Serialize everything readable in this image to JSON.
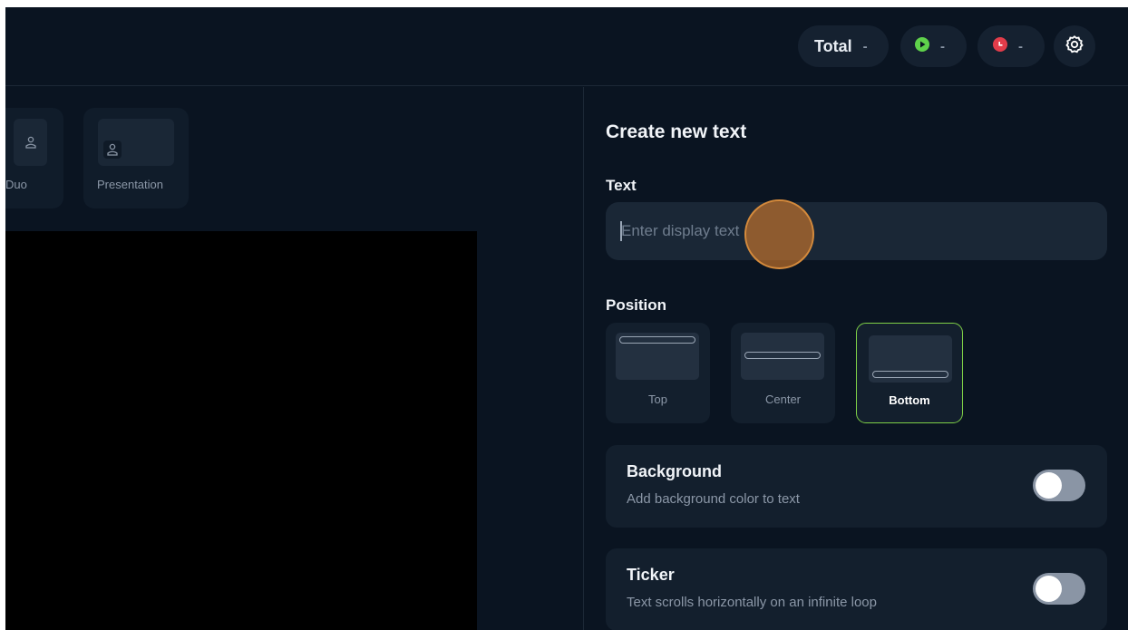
{
  "header": {
    "total_label": "Total",
    "total_value": "-",
    "live_value": "-",
    "recording_value": "-",
    "live_icon": "play-icon",
    "recording_icon": "record-icon",
    "settings_icon": "gear-icon",
    "colors": {
      "live": "#5fd14b",
      "recording": "#e23c4a"
    }
  },
  "layouts": [
    {
      "label": "Duo",
      "icon": "user-icon"
    },
    {
      "label": "Presentation",
      "icon": "user-icon"
    }
  ],
  "panel": {
    "title": "Create new text",
    "text_section_label": "Text",
    "text_input_placeholder": "Enter display text",
    "text_input_value": "",
    "position_section_label": "Position",
    "positions": [
      {
        "label": "Top",
        "selected": false
      },
      {
        "label": "Center",
        "selected": false
      },
      {
        "label": "Bottom",
        "selected": true
      }
    ],
    "options": [
      {
        "title": "Background",
        "description": "Add background color to text",
        "enabled": false
      },
      {
        "title": "Ticker",
        "description": "Text scrolls horizontally on an infinite loop",
        "enabled": false
      }
    ],
    "accent_color": "#7ecf47"
  }
}
